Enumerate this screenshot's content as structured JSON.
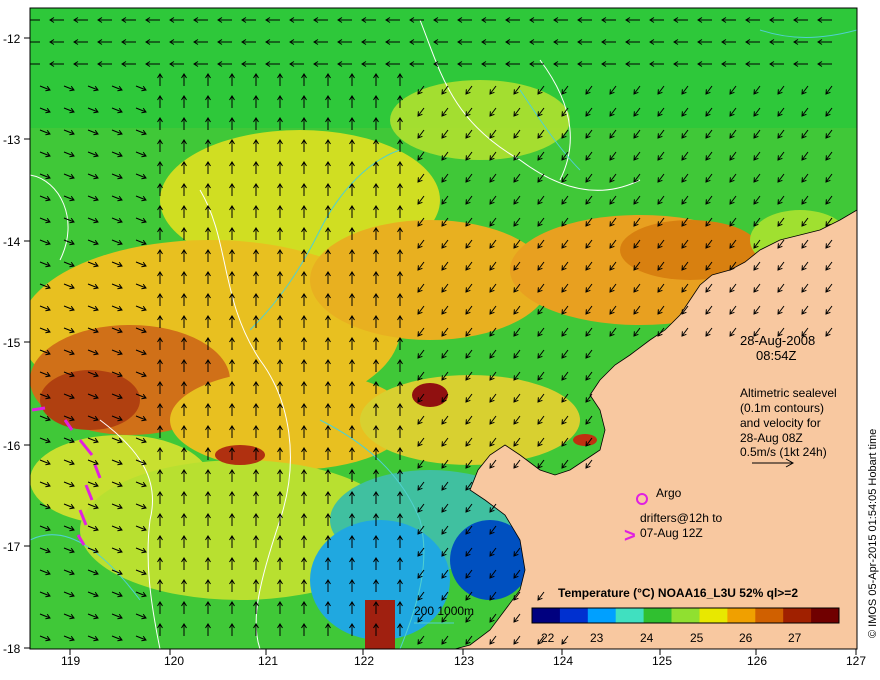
{
  "map": {
    "x_ticks": [
      "119",
      "120",
      "121",
      "122",
      "123",
      "124",
      "125",
      "126",
      "127"
    ],
    "y_ticks": [
      "-12",
      "-13",
      "-14",
      "-15",
      "-16",
      "-17",
      "-18"
    ]
  },
  "annotation": {
    "date": "28-Aug-2008",
    "time": "08:54Z",
    "altimetric": [
      "Altimetric sealevel",
      "(0.1m contours)",
      "and velocity for",
      "28-Aug 08Z",
      "0.5m/s (1kt 24h)"
    ]
  },
  "legend": {
    "argo_label": "Argo",
    "drifters_line1": "drifters@12h to",
    "drifters_line2": "07-Aug 12Z",
    "drifter_symbol": ">",
    "depth_label": "200  1000m"
  },
  "colorbar": {
    "title": "Temperature (°C) NOAA16_L3U 52% ql>=2",
    "tick_labels": [
      "22",
      "23",
      "24",
      "25",
      "26",
      "27"
    ],
    "colors": [
      "#00007f",
      "#0030d0",
      "#00a0ff",
      "#40e0c0",
      "#30c030",
      "#90e030",
      "#e8e800",
      "#f0a000",
      "#d06000",
      "#a02000",
      "#700000"
    ]
  },
  "credit": "© IMOS 05-Apr-2015 01:54:05 Hobart time",
  "colors": {
    "land": "#f8c8a0",
    "argo": "#e020e0",
    "contour": "#50d0d0"
  }
}
